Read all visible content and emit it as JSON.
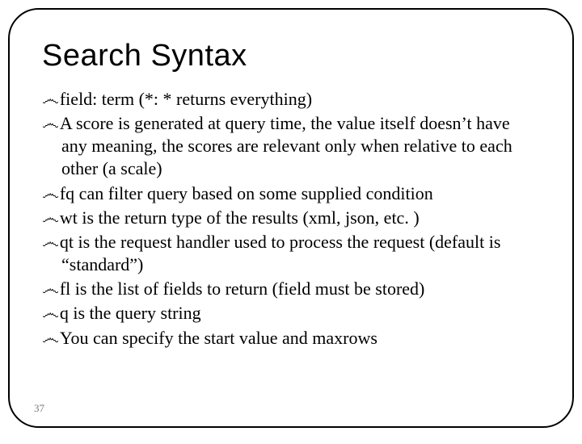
{
  "title": "Search Syntax",
  "bullet_glyph": "෴",
  "items": [
    "field: term (*: * returns everything)",
    "A score is generated at query time, the value itself doesn’t have any meaning, the scores are relevant only when relative to each other (a scale)",
    "fq can filter query based on some supplied condition",
    "wt is the return type of the results (xml, json, etc. )",
    "qt is the request handler used to process the request (default is “standard”)",
    "fl is the list of fields to return (field must be stored)",
    "q is the query string",
    "You can specify the start value and maxrows"
  ],
  "page_number": "37"
}
